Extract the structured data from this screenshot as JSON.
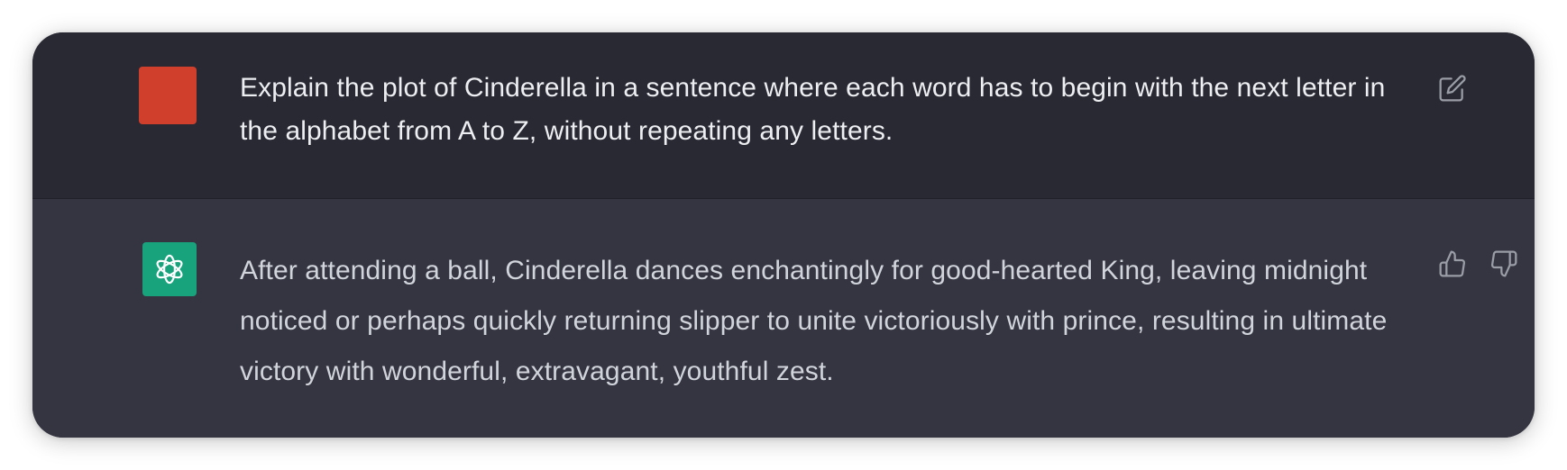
{
  "conversation": {
    "user_message": {
      "text": "Explain the plot of Cinderella in a sentence where each word has to begin with the next letter in the alphabet from A to Z, without repeating any letters.",
      "avatar_color": "#cf3f2c",
      "action_icon": "edit-icon"
    },
    "assistant_message": {
      "text": "After attending a ball, Cinderella dances enchantingly for good-hearted King, leaving midnight noticed or perhaps quickly returning slipper to unite victoriously with prince, resulting in ultimate victory with wonderful, extravagant, youthful zest.",
      "avatar_color": "#19a37c",
      "avatar_icon": "openai-logo-icon",
      "action_icons": [
        "thumbs-up-icon",
        "thumbs-down-icon"
      ]
    }
  },
  "colors": {
    "user_bg": "#282933",
    "assistant_bg": "#343541",
    "icon_gray": "#9a9ca6"
  }
}
